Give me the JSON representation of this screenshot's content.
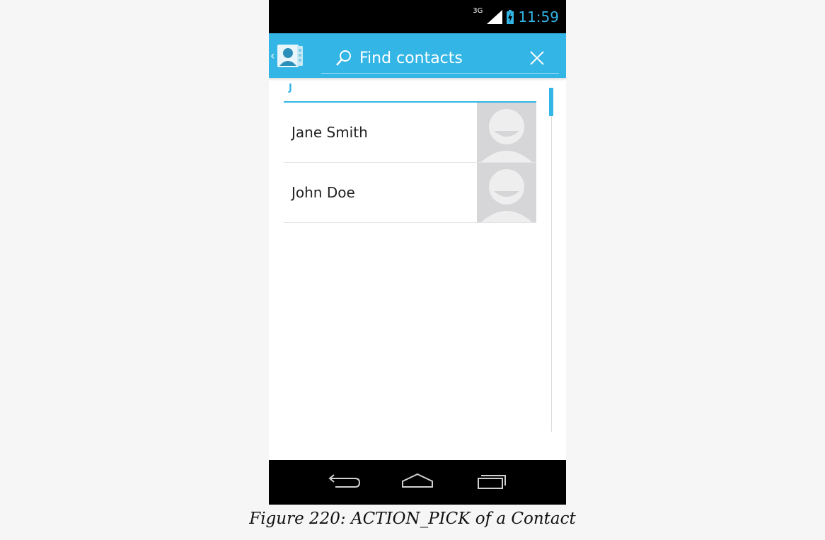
{
  "status_bar": {
    "network_type": "3G",
    "time": "11:59",
    "signal_icon": "signal-bars-icon",
    "battery_icon": "battery-charging-icon"
  },
  "action_bar": {
    "up_icon": "up-caret-icon",
    "app_icon": "contacts-app-icon",
    "search": {
      "placeholder": "Find contacts",
      "value": "",
      "icon": "search-icon"
    },
    "clear_icon": "close-icon"
  },
  "contacts": {
    "section_letter": "J",
    "items": [
      {
        "name": "Jane Smith",
        "photo": "default-avatar-icon"
      },
      {
        "name": "John Doe",
        "photo": "default-avatar-icon"
      }
    ]
  },
  "nav_bar": {
    "back_icon": "back-icon",
    "home_icon": "home-icon",
    "recents_icon": "recent-apps-icon"
  },
  "caption": "Figure 220: ACTION_PICK of a Contact",
  "colors": {
    "accent": "#33b5e5",
    "background": "#f6f6f6",
    "bar_dark": "#000000"
  }
}
